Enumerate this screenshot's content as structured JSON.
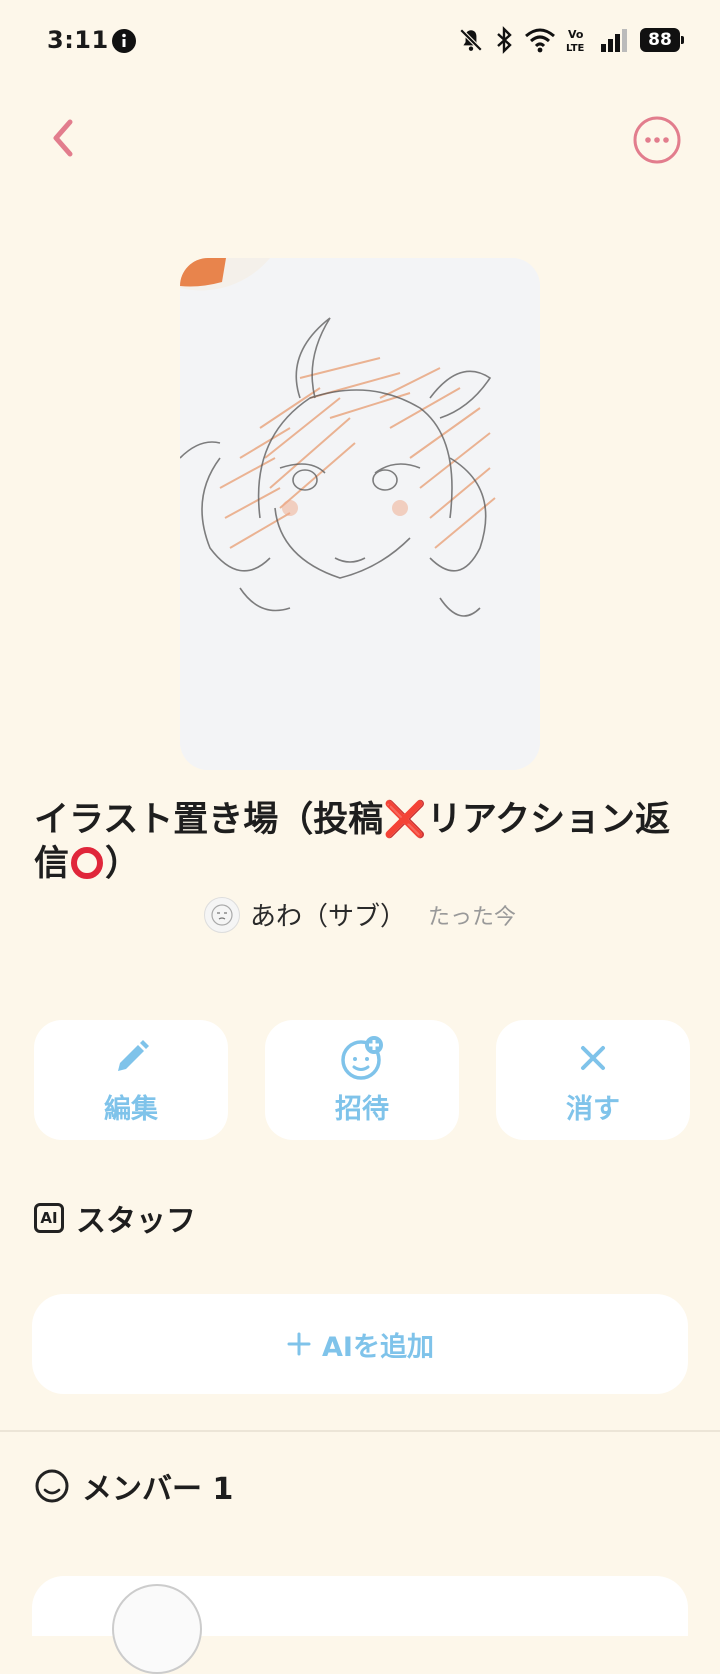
{
  "status_bar": {
    "time": "3:11",
    "battery": "88",
    "icons": [
      "info-icon",
      "bell-off-icon",
      "bluetooth-icon",
      "wifi-icon",
      "volte-icon",
      "signal-icon",
      "battery-icon"
    ]
  },
  "header": {
    "back_icon": "chevron-left-icon",
    "more_icon": "more-horizontal-icon",
    "accent_color": "#e27d8d"
  },
  "board": {
    "title_part1": "イラスト置き場（投稿",
    "title_x": "❌",
    "title_part2": "リアクション返信",
    "title_end": "）",
    "author_name": "あわ（サブ）",
    "posted_time": "たった今"
  },
  "actions": {
    "edit_label": "編集",
    "invite_label": "招待",
    "delete_label": "消す",
    "color": "#7fc3ea"
  },
  "staff": {
    "section_label": "スタッフ",
    "ai_badge": "AI",
    "add_ai_label": "AIを追加"
  },
  "members": {
    "section_label": "メンバー 1"
  }
}
